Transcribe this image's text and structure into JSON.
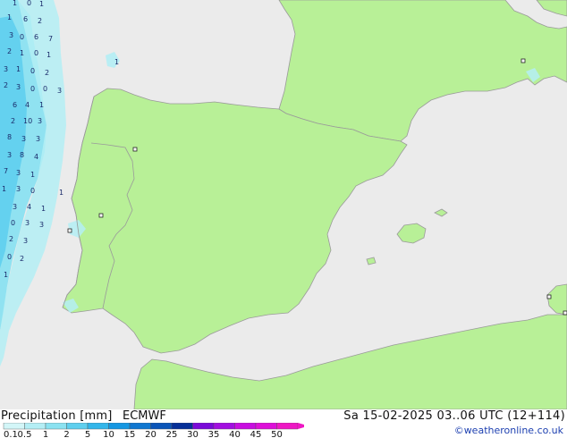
{
  "map": {
    "precip_values": [
      "1",
      "0",
      "1",
      "1",
      "6",
      "2",
      "3",
      "0",
      "6",
      "7",
      "2",
      "1",
      "0",
      "1",
      "1",
      "3",
      "1",
      "0",
      "2",
      "2",
      "3",
      "0",
      "0",
      "3",
      "6",
      "4",
      "1",
      "2",
      "10",
      "3",
      "8",
      "3",
      "3",
      "3",
      "8",
      "4",
      "7",
      "3",
      "1",
      "1",
      "3",
      "0",
      "1",
      "3",
      "4",
      "1",
      "0",
      "3",
      "3",
      "2",
      "3",
      "0",
      "2",
      "1"
    ],
    "colors": {
      "land": "#b8f097",
      "sea": "#ebebeb",
      "coast": "#9a9a9a",
      "border": "#9a9a9a"
    }
  },
  "footer": {
    "title": "Precipitation [mm]",
    "model": "ECMWF",
    "valid_time": "Sa 15-02-2025 03..06 UTC (12+114)",
    "credit": "©weatheronline.co.uk"
  },
  "legend": {
    "labels": [
      "0.1",
      "0.5",
      "1",
      "2",
      "5",
      "10",
      "15",
      "20",
      "25",
      "30",
      "35",
      "40",
      "45",
      "50"
    ],
    "colors": [
      "#d3f6f8",
      "#b4eef5",
      "#8be2f1",
      "#5fcfee",
      "#33b6ea",
      "#1597e2",
      "#1077d0",
      "#0b55b8",
      "#062f98",
      "#7a0ad8",
      "#a20fe0",
      "#c80ee0",
      "#dd10d8",
      "#ee18c4"
    ]
  }
}
